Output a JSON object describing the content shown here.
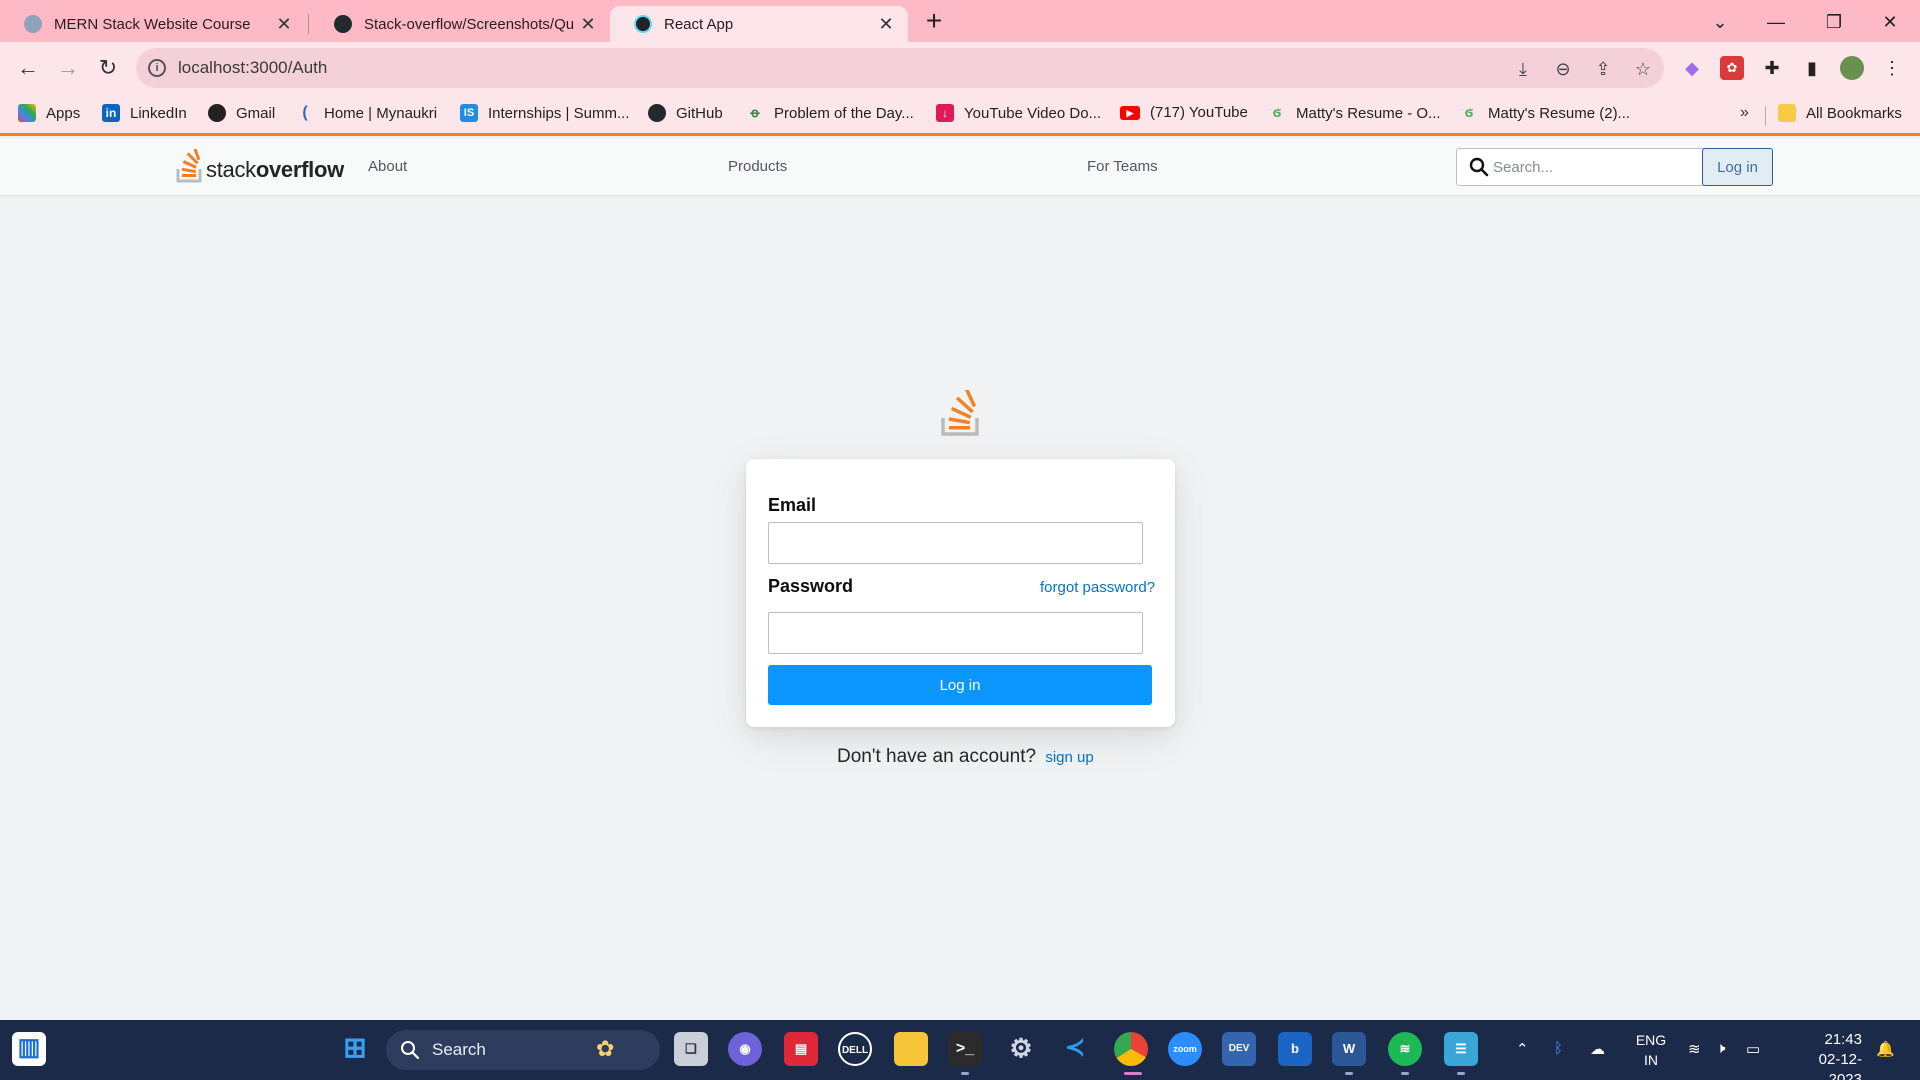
{
  "browser": {
    "tabs": [
      {
        "title": "MERN Stack Website Course",
        "active": false
      },
      {
        "title": "Stack-overflow/Screenshots/Qu",
        "active": false
      },
      {
        "title": "React App",
        "active": true
      }
    ],
    "url": "localhost:3000/Auth",
    "bookmarks": [
      {
        "label": "Apps",
        "icon": "apps-grid-icon"
      },
      {
        "label": "LinkedIn",
        "icon": "linkedin-icon"
      },
      {
        "label": "Gmail",
        "icon": "gmail-icon"
      },
      {
        "label": "Home | Mynaukri",
        "icon": "mynaukri-icon"
      },
      {
        "label": "Internships | Summ...",
        "icon": "internshala-icon"
      },
      {
        "label": "GitHub",
        "icon": "github-icon"
      },
      {
        "label": "Problem of the Day...",
        "icon": "gfg-icon"
      },
      {
        "label": "YouTube Video Do...",
        "icon": "download-icon"
      },
      {
        "label": "(717) YouTube",
        "icon": "youtube-icon"
      },
      {
        "label": "Matty's Resume - O...",
        "icon": "resume-icon"
      },
      {
        "label": "Matty's Resume (2)...",
        "icon": "resume-icon"
      }
    ],
    "bookmarks_more": "»",
    "all_bookmarks": "All Bookmarks"
  },
  "navbar": {
    "logo_stack": "stack",
    "logo_overflow": "overflow",
    "links": [
      "About",
      "Products",
      "For Teams"
    ],
    "search_placeholder": "Search...",
    "login_label": "Log in"
  },
  "auth": {
    "email_label": "Email",
    "password_label": "Password",
    "forgot_label": "forgot password?",
    "submit_label": "Log in",
    "no_account_text": "Don't have an account?",
    "signup_label": "sign up"
  },
  "taskbar": {
    "search_label": "Search",
    "language": "ENG",
    "region": "IN",
    "time": "21:43",
    "date": "02-12-2023"
  },
  "colors": {
    "so_orange": "#f48024",
    "so_blue_button": "#0a95ff",
    "link_blue": "#0074cc",
    "tabbar_pink": "#fdbac6"
  }
}
